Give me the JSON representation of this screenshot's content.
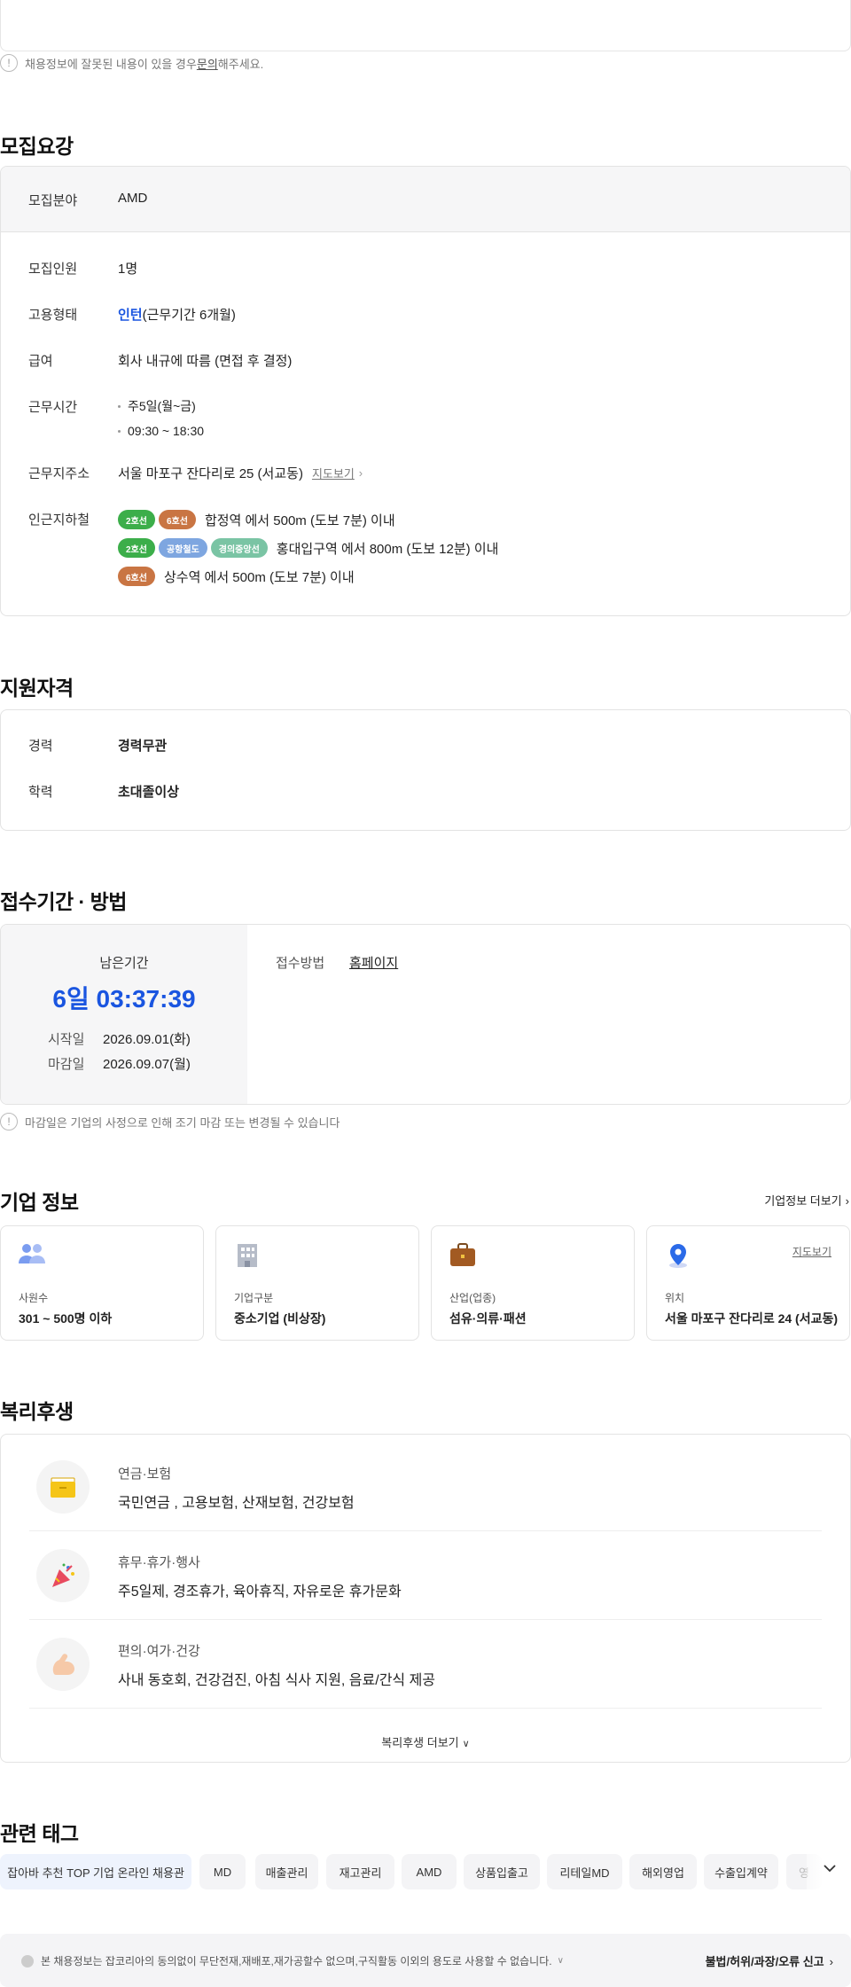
{
  "top_notice": {
    "before": "채용정보에 잘못된 내용이 있을 경우 ",
    "link": "문의",
    "after": "해주세요."
  },
  "recruit": {
    "title": "모집요강",
    "field_label": "모집분야",
    "field_value": "AMD",
    "headcount_label": "모집인원",
    "headcount_value": "1명",
    "type_label": "고용형태",
    "type_value": "인턴",
    "type_detail": "(근무기간 6개월)",
    "salary_label": "급여",
    "salary_value": "회사 내규에 따름 (면접 후 결정)",
    "hours_label": "근무시간",
    "hours": [
      "주5일(월~금)",
      "09:30 ~ 18:30"
    ],
    "address_label": "근무지주소",
    "address_value": "서울 마포구 잔다리로 25 (서교동)",
    "map_link": "지도보기",
    "subway_label": "인근지하철",
    "subway": [
      {
        "lines": [
          {
            "name": "2호선",
            "color": "#3cae4a"
          },
          {
            "name": "6호선",
            "color": "#c97543"
          }
        ],
        "text": "합정역 에서 500m (도보 7분) 이내"
      },
      {
        "lines": [
          {
            "name": "2호선",
            "color": "#3cae4a"
          },
          {
            "name": "공항철도",
            "color": "#7ea6e0"
          },
          {
            "name": "경의중앙선",
            "color": "#7ac4a4"
          }
        ],
        "text": "홍대입구역 에서 800m (도보 12분) 이내"
      },
      {
        "lines": [
          {
            "name": "6호선",
            "color": "#c97543"
          }
        ],
        "text": "상수역 에서 500m (도보 7분) 이내"
      }
    ]
  },
  "qualification": {
    "title": "지원자격",
    "career_label": "경력",
    "career_value": "경력무관",
    "edu_label": "학력",
    "edu_value": "초대졸이상"
  },
  "apply": {
    "title": "접수기간 · 방법",
    "remain_label": "남은기간",
    "remain_value": "6일 03:37:39",
    "start_label": "시작일",
    "start_value": "2026.09.01(화)",
    "end_label": "마감일",
    "end_value": "2026.09.07(월)",
    "method_label": "접수방법",
    "method_value": "홈페이지",
    "notice": "마감일은 기업의 사정으로 인해 조기 마감 또는 변경될 수 있습니다"
  },
  "company": {
    "title": "기업 정보",
    "more": "기업정보 더보기",
    "cards": [
      {
        "label": "사원수",
        "value": "301 ~ 500명 이하",
        "icon": "people-icon"
      },
      {
        "label": "기업구분",
        "value": "중소기업 (비상장)",
        "icon": "building-icon"
      },
      {
        "label": "산업(업종)",
        "value": "섬유·의류·패션",
        "icon": "briefcase-icon"
      },
      {
        "label": "위치",
        "value": "서울 마포구 잔다리로 24 (서교동)",
        "icon": "location-icon",
        "map": "지도보기"
      }
    ]
  },
  "welfare": {
    "title": "복리후생",
    "items": [
      {
        "category": "연금·보험",
        "value": "국민연금 , 고용보험, 산재보험, 건강보험",
        "icon": "folder-icon"
      },
      {
        "category": "휴무·휴가·행사",
        "value": "주5일제, 경조휴가, 육아휴직, 자유로운 휴가문화",
        "icon": "party-popper-icon"
      },
      {
        "category": "편의·여가·건강",
        "value": "사내 동호회, 건강검진, 아침 식사 지원, 음료/간식 제공",
        "icon": "muscle-icon"
      }
    ],
    "more": "복리후생 더보기"
  },
  "tags": {
    "title": "관련 태그",
    "items": [
      "잡아바 추천 TOP 기업 온라인 채용관",
      "MD",
      "매출관리",
      "재고관리",
      "AMD",
      "상품입출고",
      "리테일MD",
      "해외영업",
      "수출입계약",
      "영"
    ]
  },
  "footer": {
    "notice": "본 채용정보는 잡코리아의 동의없이 무단전재,재배포,재가공할수 없으며,구직활동 이외의 용도로 사용할 수 없습니다.",
    "report": "불법/허위/과장/오류 신고"
  },
  "colors": {
    "accent": "#1a55e0",
    "border": "#e3e3e3",
    "subtle_bg": "#f6f6f7"
  }
}
